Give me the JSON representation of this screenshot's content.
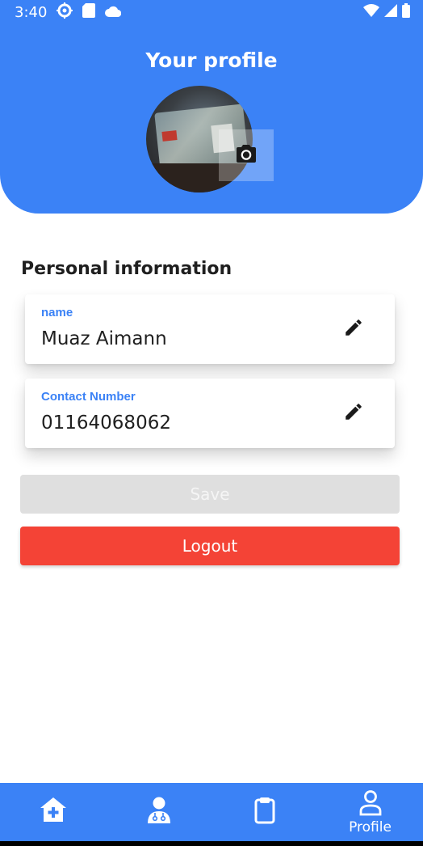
{
  "status_bar": {
    "time": "3:40",
    "left_icons": [
      "settings-icon",
      "sd-card-icon",
      "cloud-icon"
    ],
    "right_icons": [
      "wifi-icon",
      "signal-icon",
      "battery-icon"
    ]
  },
  "header": {
    "title": "Your profile",
    "avatar_icon": "camera-icon"
  },
  "personal_info": {
    "section_title": "Personal information",
    "fields": [
      {
        "label": "name",
        "value": "Muaz Aimann",
        "action_icon": "edit-pencil-icon"
      },
      {
        "label": "Contact Number",
        "value": "01164068062",
        "action_icon": "edit-pencil-icon"
      }
    ]
  },
  "actions": {
    "save_label": "Save",
    "logout_label": "Logout"
  },
  "bottom_nav": {
    "items": [
      {
        "icon": "home-plus-icon",
        "label": ""
      },
      {
        "icon": "doctor-icon",
        "label": ""
      },
      {
        "icon": "clipboard-icon",
        "label": ""
      },
      {
        "icon": "profile-icon",
        "label": "Profile"
      }
    ]
  },
  "colors": {
    "primary": "#3b82f6",
    "danger": "#f44336",
    "disabled": "#dfdfdf"
  }
}
